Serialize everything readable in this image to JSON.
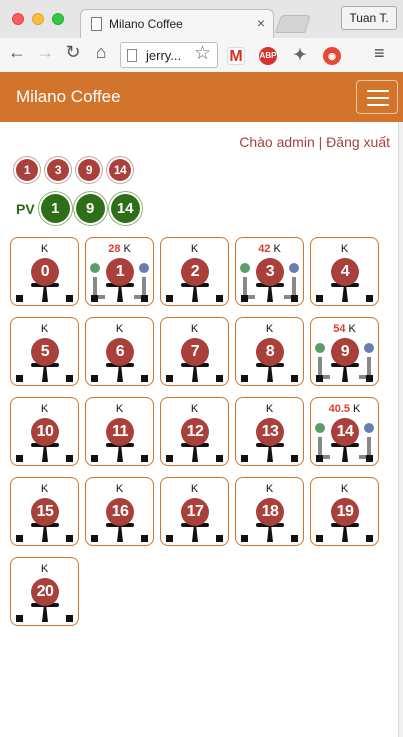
{
  "browser": {
    "tab_title": "Milano Coffee",
    "tab_close": "×",
    "profile": "Tuan T.",
    "url": "jerry...",
    "back": "←",
    "forward": "→",
    "reload": "↻",
    "home": "⌂",
    "star": "☆",
    "menu": "≡",
    "ext_gmail": "M",
    "ext_abp": "ABP",
    "ext_puzzle": "✦",
    "ext_owl": "◉"
  },
  "navbar": {
    "brand": "Milano Coffee"
  },
  "user": {
    "greeting": "Chào admin",
    "separator": " | ",
    "logout": "Đăng xuất"
  },
  "pending_orders": [
    "1",
    "3",
    "9",
    "14"
  ],
  "pv": {
    "label": "PV",
    "items": [
      "1",
      "9",
      "14"
    ]
  },
  "tables": [
    {
      "num": "0",
      "k": "K",
      "amount": "",
      "occupied": false
    },
    {
      "num": "1",
      "k": "K",
      "amount": "28",
      "occupied": true
    },
    {
      "num": "2",
      "k": "K",
      "amount": "",
      "occupied": false
    },
    {
      "num": "3",
      "k": "K",
      "amount": "42",
      "occupied": true
    },
    {
      "num": "4",
      "k": "K",
      "amount": "",
      "occupied": false
    },
    {
      "num": "5",
      "k": "K",
      "amount": "",
      "occupied": false
    },
    {
      "num": "6",
      "k": "K",
      "amount": "",
      "occupied": false
    },
    {
      "num": "7",
      "k": "K",
      "amount": "",
      "occupied": false
    },
    {
      "num": "8",
      "k": "K",
      "amount": "",
      "occupied": false
    },
    {
      "num": "9",
      "k": "K",
      "amount": "54",
      "occupied": true
    },
    {
      "num": "10",
      "k": "K",
      "amount": "",
      "occupied": false
    },
    {
      "num": "11",
      "k": "K",
      "amount": "",
      "occupied": false
    },
    {
      "num": "12",
      "k": "K",
      "amount": "",
      "occupied": false
    },
    {
      "num": "13",
      "k": "K",
      "amount": "",
      "occupied": false
    },
    {
      "num": "14",
      "k": "K",
      "amount": "40.5",
      "occupied": true
    },
    {
      "num": "15",
      "k": "K",
      "amount": "",
      "occupied": false
    },
    {
      "num": "16",
      "k": "K",
      "amount": "",
      "occupied": false
    },
    {
      "num": "17",
      "k": "K",
      "amount": "",
      "occupied": false
    },
    {
      "num": "18",
      "k": "K",
      "amount": "",
      "occupied": false
    },
    {
      "num": "19",
      "k": "K",
      "amount": "",
      "occupied": false
    },
    {
      "num": "20",
      "k": "K",
      "amount": "",
      "occupied": false
    }
  ],
  "colors": {
    "brand": "#d3742c",
    "table_badge": "#a9403b",
    "pv_badge": "#2f6e19",
    "amount": "#e03c2f"
  }
}
